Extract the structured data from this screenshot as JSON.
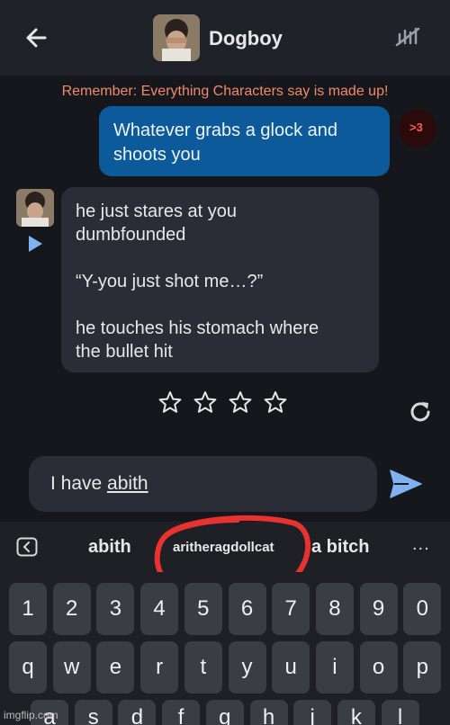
{
  "header": {
    "title": "Dogboy"
  },
  "notice": "Remember: Everything Characters say is made up!",
  "user_message": {
    "lines": [
      "Whatever grabs a glock and",
      "shoots you"
    ],
    "avatar_text": ">3"
  },
  "bot_message": {
    "lines": [
      "he just stares at you",
      "dumbfounded",
      "",
      "“Y-you just shot me…?”",
      "",
      "he touches his stomach where",
      "the bullet hit"
    ]
  },
  "rating": {
    "stars_filled": 0,
    "stars_total": 4
  },
  "composer": {
    "prefix": "I have ",
    "typed_word": "abith"
  },
  "suggestions": {
    "left": "abith",
    "middle": "aritheragdollcat",
    "right": "a bitch",
    "more": "..."
  },
  "keyboard": {
    "row1": [
      "1",
      "2",
      "3",
      "4",
      "5",
      "6",
      "7",
      "8",
      "9",
      "0"
    ],
    "row2": [
      "q",
      "w",
      "e",
      "r",
      "t",
      "y",
      "u",
      "i",
      "o",
      "p"
    ],
    "row3": [
      "a",
      "s",
      "d",
      "f",
      "g",
      "h",
      "j",
      "k",
      "l"
    ]
  },
  "watermark": "imgflip.com",
  "colors": {
    "accent": "#0c5a9a",
    "notice": "#f08a6a",
    "annotation": "#e8322f",
    "send": "#7fb2f0"
  }
}
